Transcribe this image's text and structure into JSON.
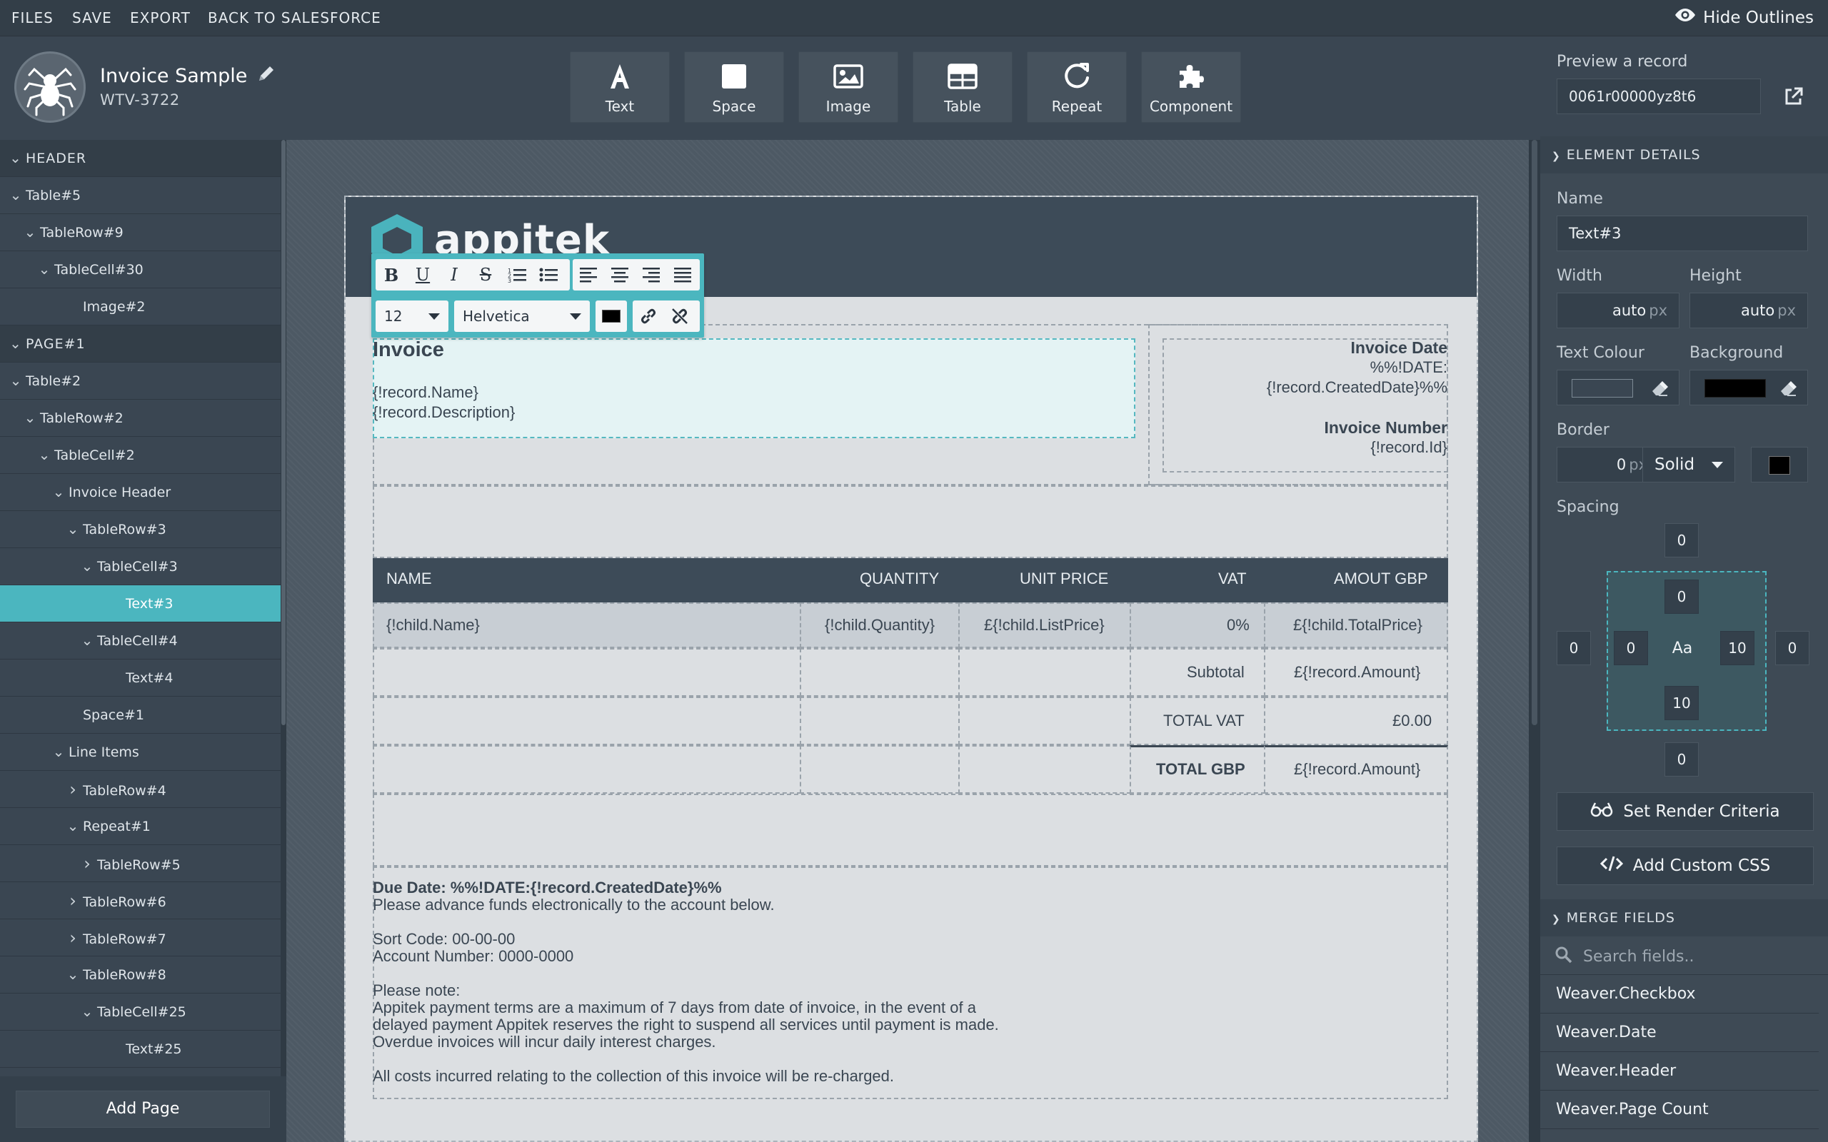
{
  "menubar": {
    "items": [
      "FILES",
      "SAVE",
      "EXPORT",
      "BACK TO SALESFORCE"
    ],
    "hide_outlines": "Hide Outlines"
  },
  "document": {
    "title": "Invoice Sample",
    "id": "WTV-3722"
  },
  "tools": [
    {
      "label": "Text",
      "icon": "text-icon"
    },
    {
      "label": "Space",
      "icon": "space-icon"
    },
    {
      "label": "Image",
      "icon": "image-icon"
    },
    {
      "label": "Table",
      "icon": "table-icon"
    },
    {
      "label": "Repeat",
      "icon": "repeat-icon"
    },
    {
      "label": "Component",
      "icon": "component-icon"
    }
  ],
  "preview": {
    "label": "Preview a record",
    "value": "0061r00000yz8t6"
  },
  "tree": [
    {
      "label": "HEADER",
      "depth": 0,
      "chev": "down",
      "section": true
    },
    {
      "label": "Table#5",
      "depth": 0,
      "chev": "down"
    },
    {
      "label": "TableRow#9",
      "depth": 1,
      "chev": "down"
    },
    {
      "label": "TableCell#30",
      "depth": 2,
      "chev": "down"
    },
    {
      "label": "Image#2",
      "depth": 4,
      "chev": ""
    },
    {
      "label": "PAGE#1",
      "depth": 0,
      "chev": "down",
      "section": true
    },
    {
      "label": "Table#2",
      "depth": 0,
      "chev": "down"
    },
    {
      "label": "TableRow#2",
      "depth": 1,
      "chev": "down"
    },
    {
      "label": "TableCell#2",
      "depth": 2,
      "chev": "down"
    },
    {
      "label": "Invoice Header",
      "depth": 3,
      "chev": "down"
    },
    {
      "label": "TableRow#3",
      "depth": 4,
      "chev": "down"
    },
    {
      "label": "TableCell#3",
      "depth": 5,
      "chev": "down"
    },
    {
      "label": "Text#3",
      "depth": 7,
      "chev": "",
      "active": true
    },
    {
      "label": "TableCell#4",
      "depth": 5,
      "chev": "down"
    },
    {
      "label": "Text#4",
      "depth": 7,
      "chev": ""
    },
    {
      "label": "Space#1",
      "depth": 4,
      "chev": ""
    },
    {
      "label": "Line Items",
      "depth": 3,
      "chev": "down"
    },
    {
      "label": "TableRow#4",
      "depth": 4,
      "chev": "right"
    },
    {
      "label": "Repeat#1",
      "depth": 4,
      "chev": "down"
    },
    {
      "label": "TableRow#5",
      "depth": 5,
      "chev": "right"
    },
    {
      "label": "TableRow#6",
      "depth": 4,
      "chev": "right"
    },
    {
      "label": "TableRow#7",
      "depth": 4,
      "chev": "right"
    },
    {
      "label": "TableRow#8",
      "depth": 4,
      "chev": "down"
    },
    {
      "label": "TableCell#25",
      "depth": 5,
      "chev": "down"
    },
    {
      "label": "Text#25",
      "depth": 7,
      "chev": ""
    }
  ],
  "add_page": "Add Page",
  "brand": "appitek",
  "rte": {
    "font_size": "12",
    "font_family": "Helvetica",
    "color": "#000000"
  },
  "invoice": {
    "title": "Invoice",
    "name": "{!record.Name}",
    "description": "{!record.Description}",
    "date_label": "Invoice Date",
    "date_value_1": "%%!DATE:",
    "date_value_2": "{!record.CreatedDate}%%",
    "number_label": "Invoice Number",
    "number_value": "{!record.Id}"
  },
  "table": {
    "headers": [
      "NAME",
      "QUANTITY",
      "UNIT PRICE",
      "VAT",
      "AMOUT GBP"
    ],
    "row": [
      "{!child.Name}",
      "{!child.Quantity}",
      "£{!child.ListPrice}",
      "0%",
      "£{!child.TotalPrice}"
    ],
    "subtotal_label": "Subtotal",
    "subtotal_value": "£{!record.Amount}",
    "vat_label": "TOTAL VAT",
    "vat_value": "£0.00",
    "total_label": "TOTAL GBP",
    "total_value": "£{!record.Amount}"
  },
  "footer": {
    "due": "Due Date: %%!DATE:{!record.CreatedDate}%%",
    "advance": "Please advance funds electronically to the account below.",
    "sort_code": "Sort Code: 00-00-00",
    "account": "Account Number: 0000-0000",
    "note_head": "Please note:",
    "note_1": "Appitek payment terms are a maximum of 7 days from date of invoice, in the event of a",
    "note_2": "delayed payment Appitek reserves the right to suspend all services until payment is made.",
    "note_3": "Overdue invoices will incur daily interest charges.",
    "costs": "All costs incurred relating to the collection of this invoice will be re-charged."
  },
  "details": {
    "section": "ELEMENT DETAILS",
    "name_label": "Name",
    "name_value": "Text#3",
    "width_label": "Width",
    "width_value": "auto",
    "height_label": "Height",
    "height_value": "auto",
    "unit": "px",
    "text_colour_label": "Text Colour",
    "text_colour": "#3a4652",
    "background_label": "Background",
    "background_colour": "#000000",
    "border_label": "Border",
    "border_value": "0",
    "border_style": "Solid",
    "border_colour": "#000000",
    "spacing_label": "Spacing",
    "margin": {
      "top": "0",
      "right": "0",
      "bottom": "0",
      "left": "0"
    },
    "padding": {
      "top": "0",
      "right": "10",
      "bottom": "10",
      "left": "0"
    },
    "spacing_center": "Aa",
    "render_criteria": "Set Render Criteria",
    "custom_css": "Add Custom CSS"
  },
  "merge": {
    "section": "MERGE FIELDS",
    "search_placeholder": "Search fields..",
    "items": [
      "Weaver.Checkbox",
      "Weaver.Date",
      "Weaver.Header",
      "Weaver.Page Count"
    ]
  }
}
